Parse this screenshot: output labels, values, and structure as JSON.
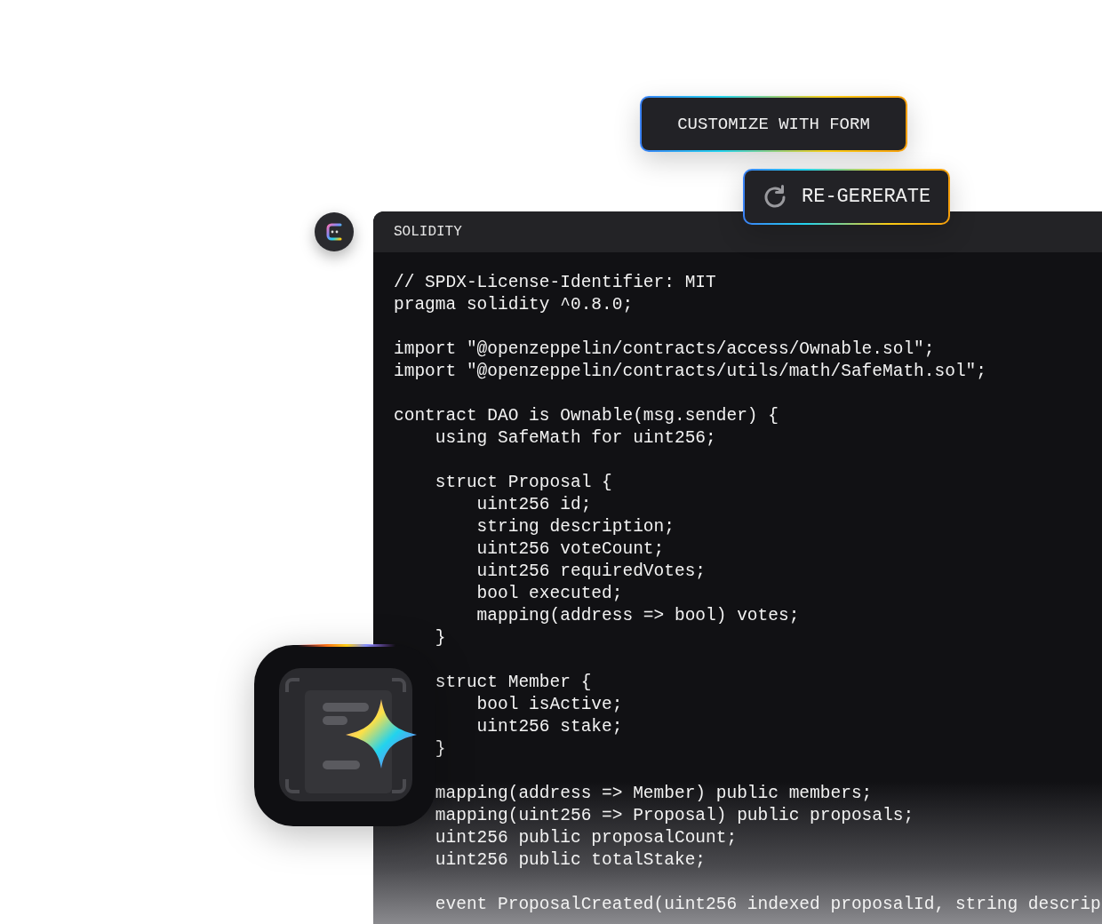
{
  "buttons": [
    {
      "label": "CUSTOMIZE WITH FORM",
      "kind": "plain"
    },
    {
      "label": "RE-GERERATE",
      "kind": "refresh"
    }
  ],
  "code_panel": {
    "language": "SOLIDITY",
    "blocks": [
      [
        "// SPDX-License-Identifier: MIT",
        "pragma solidity ^0.8.0;"
      ],
      [
        "import \"@openzeppelin/contracts/access/Ownable.sol\";",
        "import \"@openzeppelin/contracts/utils/math/SafeMath.sol\";"
      ],
      [
        "contract DAO is Ownable(msg.sender) {",
        "    using SafeMath for uint256;"
      ],
      [
        "    struct Proposal {",
        "        uint256 id;",
        "        string description;",
        "        uint256 voteCount;",
        "        uint256 requiredVotes;",
        "        bool executed;",
        "        mapping(address => bool) votes;",
        "    }"
      ],
      [
        "    struct Member {",
        "        bool isActive;",
        "        uint256 stake;",
        "    }"
      ],
      [
        "    mapping(address => Member) public members;",
        "    mapping(uint256 => Proposal) public proposals;",
        "    uint256 public proposalCount;",
        "    uint256 public totalStake;"
      ],
      [
        "    event ProposalCreated(uint256 indexed proposalId, string descrip"
      ]
    ]
  }
}
